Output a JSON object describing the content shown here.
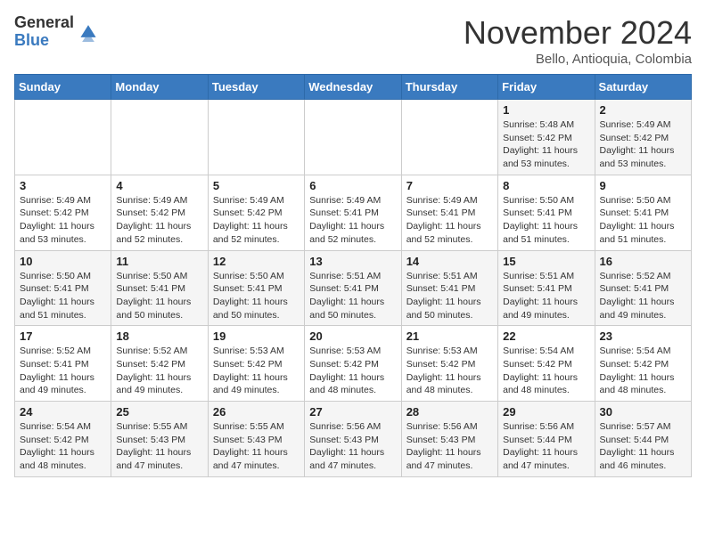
{
  "logo": {
    "general": "General",
    "blue": "Blue"
  },
  "title": "November 2024",
  "location": "Bello, Antioquia, Colombia",
  "days_of_week": [
    "Sunday",
    "Monday",
    "Tuesday",
    "Wednesday",
    "Thursday",
    "Friday",
    "Saturday"
  ],
  "weeks": [
    [
      {
        "day": "",
        "info": ""
      },
      {
        "day": "",
        "info": ""
      },
      {
        "day": "",
        "info": ""
      },
      {
        "day": "",
        "info": ""
      },
      {
        "day": "",
        "info": ""
      },
      {
        "day": "1",
        "info": "Sunrise: 5:48 AM\nSunset: 5:42 PM\nDaylight: 11 hours\nand 53 minutes."
      },
      {
        "day": "2",
        "info": "Sunrise: 5:49 AM\nSunset: 5:42 PM\nDaylight: 11 hours\nand 53 minutes."
      }
    ],
    [
      {
        "day": "3",
        "info": "Sunrise: 5:49 AM\nSunset: 5:42 PM\nDaylight: 11 hours\nand 53 minutes."
      },
      {
        "day": "4",
        "info": "Sunrise: 5:49 AM\nSunset: 5:42 PM\nDaylight: 11 hours\nand 52 minutes."
      },
      {
        "day": "5",
        "info": "Sunrise: 5:49 AM\nSunset: 5:42 PM\nDaylight: 11 hours\nand 52 minutes."
      },
      {
        "day": "6",
        "info": "Sunrise: 5:49 AM\nSunset: 5:41 PM\nDaylight: 11 hours\nand 52 minutes."
      },
      {
        "day": "7",
        "info": "Sunrise: 5:49 AM\nSunset: 5:41 PM\nDaylight: 11 hours\nand 52 minutes."
      },
      {
        "day": "8",
        "info": "Sunrise: 5:50 AM\nSunset: 5:41 PM\nDaylight: 11 hours\nand 51 minutes."
      },
      {
        "day": "9",
        "info": "Sunrise: 5:50 AM\nSunset: 5:41 PM\nDaylight: 11 hours\nand 51 minutes."
      }
    ],
    [
      {
        "day": "10",
        "info": "Sunrise: 5:50 AM\nSunset: 5:41 PM\nDaylight: 11 hours\nand 51 minutes."
      },
      {
        "day": "11",
        "info": "Sunrise: 5:50 AM\nSunset: 5:41 PM\nDaylight: 11 hours\nand 50 minutes."
      },
      {
        "day": "12",
        "info": "Sunrise: 5:50 AM\nSunset: 5:41 PM\nDaylight: 11 hours\nand 50 minutes."
      },
      {
        "day": "13",
        "info": "Sunrise: 5:51 AM\nSunset: 5:41 PM\nDaylight: 11 hours\nand 50 minutes."
      },
      {
        "day": "14",
        "info": "Sunrise: 5:51 AM\nSunset: 5:41 PM\nDaylight: 11 hours\nand 50 minutes."
      },
      {
        "day": "15",
        "info": "Sunrise: 5:51 AM\nSunset: 5:41 PM\nDaylight: 11 hours\nand 49 minutes."
      },
      {
        "day": "16",
        "info": "Sunrise: 5:52 AM\nSunset: 5:41 PM\nDaylight: 11 hours\nand 49 minutes."
      }
    ],
    [
      {
        "day": "17",
        "info": "Sunrise: 5:52 AM\nSunset: 5:41 PM\nDaylight: 11 hours\nand 49 minutes."
      },
      {
        "day": "18",
        "info": "Sunrise: 5:52 AM\nSunset: 5:42 PM\nDaylight: 11 hours\nand 49 minutes."
      },
      {
        "day": "19",
        "info": "Sunrise: 5:53 AM\nSunset: 5:42 PM\nDaylight: 11 hours\nand 49 minutes."
      },
      {
        "day": "20",
        "info": "Sunrise: 5:53 AM\nSunset: 5:42 PM\nDaylight: 11 hours\nand 48 minutes."
      },
      {
        "day": "21",
        "info": "Sunrise: 5:53 AM\nSunset: 5:42 PM\nDaylight: 11 hours\nand 48 minutes."
      },
      {
        "day": "22",
        "info": "Sunrise: 5:54 AM\nSunset: 5:42 PM\nDaylight: 11 hours\nand 48 minutes."
      },
      {
        "day": "23",
        "info": "Sunrise: 5:54 AM\nSunset: 5:42 PM\nDaylight: 11 hours\nand 48 minutes."
      }
    ],
    [
      {
        "day": "24",
        "info": "Sunrise: 5:54 AM\nSunset: 5:42 PM\nDaylight: 11 hours\nand 48 minutes."
      },
      {
        "day": "25",
        "info": "Sunrise: 5:55 AM\nSunset: 5:43 PM\nDaylight: 11 hours\nand 47 minutes."
      },
      {
        "day": "26",
        "info": "Sunrise: 5:55 AM\nSunset: 5:43 PM\nDaylight: 11 hours\nand 47 minutes."
      },
      {
        "day": "27",
        "info": "Sunrise: 5:56 AM\nSunset: 5:43 PM\nDaylight: 11 hours\nand 47 minutes."
      },
      {
        "day": "28",
        "info": "Sunrise: 5:56 AM\nSunset: 5:43 PM\nDaylight: 11 hours\nand 47 minutes."
      },
      {
        "day": "29",
        "info": "Sunrise: 5:56 AM\nSunset: 5:44 PM\nDaylight: 11 hours\nand 47 minutes."
      },
      {
        "day": "30",
        "info": "Sunrise: 5:57 AM\nSunset: 5:44 PM\nDaylight: 11 hours\nand 46 minutes."
      }
    ]
  ]
}
